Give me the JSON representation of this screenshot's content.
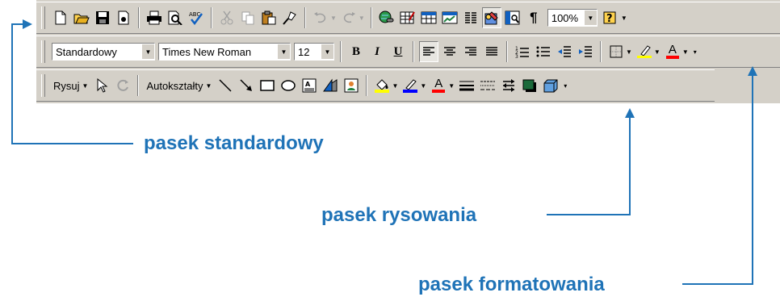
{
  "standard_toolbar": {
    "zoom_value": "100%",
    "icons": [
      "new-document-icon",
      "open-folder-icon",
      "save-icon",
      "permission-icon",
      "print-icon",
      "print-preview-icon",
      "spelling-icon",
      "cut-icon",
      "copy-icon",
      "paste-icon",
      "format-painter-icon",
      "undo-icon",
      "redo-icon",
      "hyperlink-icon",
      "tables-borders-icon",
      "insert-table-icon",
      "insert-excel-icon",
      "columns-icon",
      "drawing-icon",
      "document-map-icon",
      "show-formatting-icon",
      "help-icon"
    ]
  },
  "formatting_toolbar": {
    "style_value": "Standardowy",
    "font_value": "Times New Roman",
    "size_value": "12",
    "bold_label": "B",
    "italic_label": "I",
    "underline_label": "U",
    "font_color_letter": "A"
  },
  "drawing_toolbar": {
    "draw_menu": "Rysuj",
    "autoshapes_menu": "Autokształty",
    "font_color_letter": "A"
  },
  "labels": {
    "standard": "pasek standardowy",
    "drawing": "pasek rysowania",
    "formatting": "pasek formatowania"
  },
  "colors": {
    "annotation": "#1f73b7",
    "toolbar_bg": "#d4d0c8",
    "fill_yellow": "#ffff00",
    "line_blue": "#0000ff",
    "font_red": "#ff0000"
  }
}
